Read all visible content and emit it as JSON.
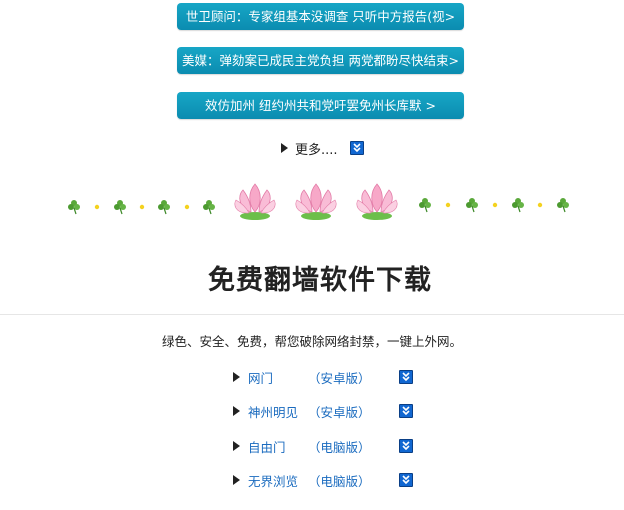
{
  "news": [
    {
      "label": "世卫顾问：专家组基本没调查 只听中方报告(视>"
    },
    {
      "label": "美媒：弹劾案已成民主党负担 两党都盼尽快结束>"
    },
    {
      "label": "效仿加州 纽约州共和党吁罢免州长库默 >"
    }
  ],
  "more": {
    "label": "更多...."
  },
  "section": {
    "title": "免费翻墙软件下载",
    "subtitle": "绿色、安全、免费，帮您破除网络封禁，一键上外网。"
  },
  "downloads": [
    {
      "name": "网门",
      "platform": "（安卓版）"
    },
    {
      "name": "神州明见",
      "platform": "（安卓版）"
    },
    {
      "name": "自由门",
      "platform": "（电脑版）"
    },
    {
      "name": "无界浏览",
      "platform": "（电脑版）"
    }
  ],
  "colors": {
    "news_button": "#0b8cb0",
    "link": "#1a6bbf",
    "download_icon": "#1167d1"
  },
  "icons": {
    "bullet": "triangle-right-icon",
    "download": "download-arrow-icon",
    "decoration": "clover-lotus-divider"
  }
}
